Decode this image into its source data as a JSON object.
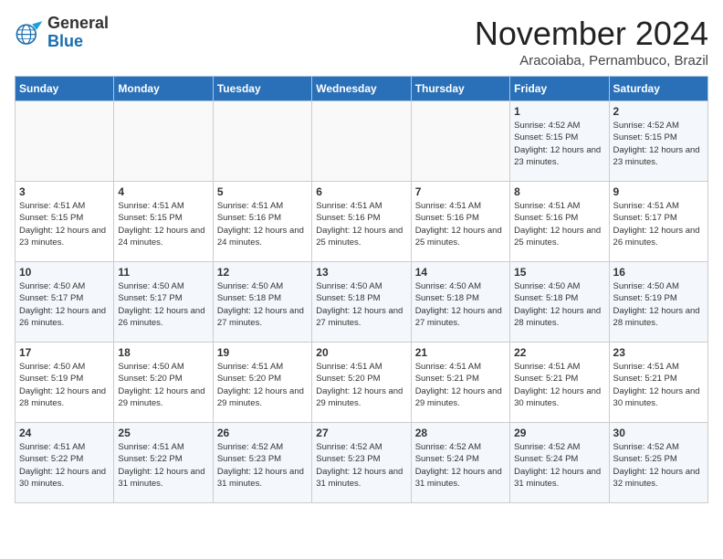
{
  "header": {
    "logo_line1": "General",
    "logo_line2": "Blue",
    "month_title": "November 2024",
    "subtitle": "Aracoiaba, Pernambuco, Brazil"
  },
  "days_of_week": [
    "Sunday",
    "Monday",
    "Tuesday",
    "Wednesday",
    "Thursday",
    "Friday",
    "Saturday"
  ],
  "weeks": [
    [
      {
        "day": "",
        "detail": ""
      },
      {
        "day": "",
        "detail": ""
      },
      {
        "day": "",
        "detail": ""
      },
      {
        "day": "",
        "detail": ""
      },
      {
        "day": "",
        "detail": ""
      },
      {
        "day": "1",
        "detail": "Sunrise: 4:52 AM\nSunset: 5:15 PM\nDaylight: 12 hours and 23 minutes."
      },
      {
        "day": "2",
        "detail": "Sunrise: 4:52 AM\nSunset: 5:15 PM\nDaylight: 12 hours and 23 minutes."
      }
    ],
    [
      {
        "day": "3",
        "detail": "Sunrise: 4:51 AM\nSunset: 5:15 PM\nDaylight: 12 hours and 23 minutes."
      },
      {
        "day": "4",
        "detail": "Sunrise: 4:51 AM\nSunset: 5:15 PM\nDaylight: 12 hours and 24 minutes."
      },
      {
        "day": "5",
        "detail": "Sunrise: 4:51 AM\nSunset: 5:16 PM\nDaylight: 12 hours and 24 minutes."
      },
      {
        "day": "6",
        "detail": "Sunrise: 4:51 AM\nSunset: 5:16 PM\nDaylight: 12 hours and 25 minutes."
      },
      {
        "day": "7",
        "detail": "Sunrise: 4:51 AM\nSunset: 5:16 PM\nDaylight: 12 hours and 25 minutes."
      },
      {
        "day": "8",
        "detail": "Sunrise: 4:51 AM\nSunset: 5:16 PM\nDaylight: 12 hours and 25 minutes."
      },
      {
        "day": "9",
        "detail": "Sunrise: 4:51 AM\nSunset: 5:17 PM\nDaylight: 12 hours and 26 minutes."
      }
    ],
    [
      {
        "day": "10",
        "detail": "Sunrise: 4:50 AM\nSunset: 5:17 PM\nDaylight: 12 hours and 26 minutes."
      },
      {
        "day": "11",
        "detail": "Sunrise: 4:50 AM\nSunset: 5:17 PM\nDaylight: 12 hours and 26 minutes."
      },
      {
        "day": "12",
        "detail": "Sunrise: 4:50 AM\nSunset: 5:18 PM\nDaylight: 12 hours and 27 minutes."
      },
      {
        "day": "13",
        "detail": "Sunrise: 4:50 AM\nSunset: 5:18 PM\nDaylight: 12 hours and 27 minutes."
      },
      {
        "day": "14",
        "detail": "Sunrise: 4:50 AM\nSunset: 5:18 PM\nDaylight: 12 hours and 27 minutes."
      },
      {
        "day": "15",
        "detail": "Sunrise: 4:50 AM\nSunset: 5:18 PM\nDaylight: 12 hours and 28 minutes."
      },
      {
        "day": "16",
        "detail": "Sunrise: 4:50 AM\nSunset: 5:19 PM\nDaylight: 12 hours and 28 minutes."
      }
    ],
    [
      {
        "day": "17",
        "detail": "Sunrise: 4:50 AM\nSunset: 5:19 PM\nDaylight: 12 hours and 28 minutes."
      },
      {
        "day": "18",
        "detail": "Sunrise: 4:50 AM\nSunset: 5:20 PM\nDaylight: 12 hours and 29 minutes."
      },
      {
        "day": "19",
        "detail": "Sunrise: 4:51 AM\nSunset: 5:20 PM\nDaylight: 12 hours and 29 minutes."
      },
      {
        "day": "20",
        "detail": "Sunrise: 4:51 AM\nSunset: 5:20 PM\nDaylight: 12 hours and 29 minutes."
      },
      {
        "day": "21",
        "detail": "Sunrise: 4:51 AM\nSunset: 5:21 PM\nDaylight: 12 hours and 29 minutes."
      },
      {
        "day": "22",
        "detail": "Sunrise: 4:51 AM\nSunset: 5:21 PM\nDaylight: 12 hours and 30 minutes."
      },
      {
        "day": "23",
        "detail": "Sunrise: 4:51 AM\nSunset: 5:21 PM\nDaylight: 12 hours and 30 minutes."
      }
    ],
    [
      {
        "day": "24",
        "detail": "Sunrise: 4:51 AM\nSunset: 5:22 PM\nDaylight: 12 hours and 30 minutes."
      },
      {
        "day": "25",
        "detail": "Sunrise: 4:51 AM\nSunset: 5:22 PM\nDaylight: 12 hours and 31 minutes."
      },
      {
        "day": "26",
        "detail": "Sunrise: 4:52 AM\nSunset: 5:23 PM\nDaylight: 12 hours and 31 minutes."
      },
      {
        "day": "27",
        "detail": "Sunrise: 4:52 AM\nSunset: 5:23 PM\nDaylight: 12 hours and 31 minutes."
      },
      {
        "day": "28",
        "detail": "Sunrise: 4:52 AM\nSunset: 5:24 PM\nDaylight: 12 hours and 31 minutes."
      },
      {
        "day": "29",
        "detail": "Sunrise: 4:52 AM\nSunset: 5:24 PM\nDaylight: 12 hours and 31 minutes."
      },
      {
        "day": "30",
        "detail": "Sunrise: 4:52 AM\nSunset: 5:25 PM\nDaylight: 12 hours and 32 minutes."
      }
    ]
  ]
}
